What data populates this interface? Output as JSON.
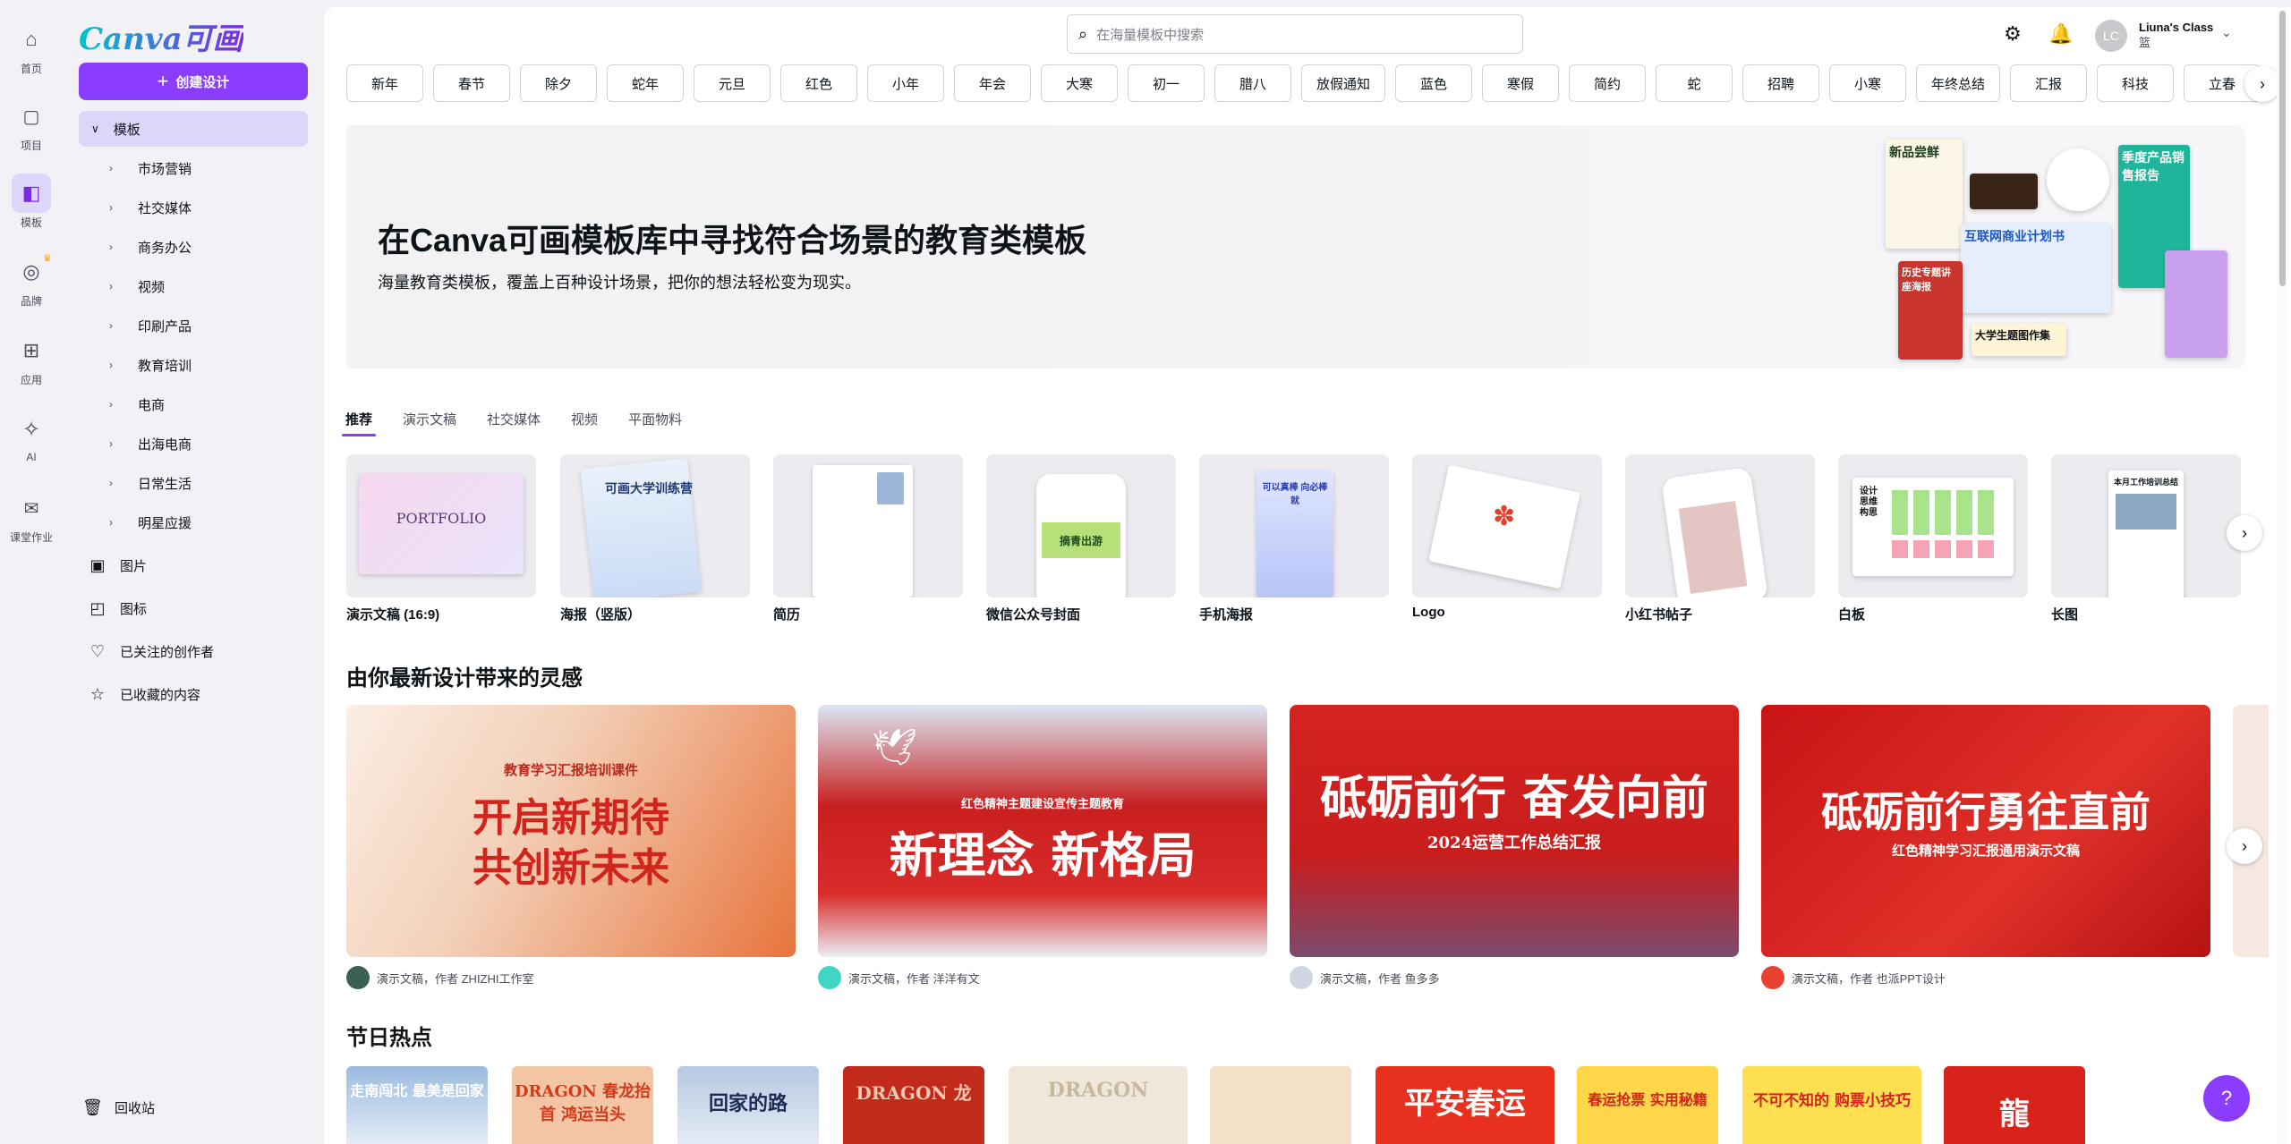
{
  "rail": [
    {
      "key": "home",
      "label": "首页",
      "icon": "⌂"
    },
    {
      "key": "projects",
      "label": "项目",
      "icon": "▢"
    },
    {
      "key": "templates",
      "label": "模板",
      "icon": "◧"
    },
    {
      "key": "brand",
      "label": "品牌",
      "icon": "◎"
    },
    {
      "key": "apps",
      "label": "应用",
      "icon": "⊞"
    },
    {
      "key": "ai",
      "label": "AI",
      "icon": "✧"
    },
    {
      "key": "classwork",
      "label": "课堂作业",
      "icon": "✉"
    }
  ],
  "panel": {
    "logo": "Canva可画",
    "create_label": "创建设计",
    "tree_head": "模板",
    "tree_items": [
      "市场营销",
      "社交媒体",
      "商务办公",
      "视频",
      "印刷产品",
      "教育培训",
      "电商",
      "出海电商",
      "日常生活",
      "明星应援"
    ],
    "links": [
      {
        "label": "图片",
        "icon": "▣"
      },
      {
        "label": "图标",
        "icon": "◰"
      },
      {
        "label": "已关注的创作者",
        "icon": "♡"
      },
      {
        "label": "已收藏的内容",
        "icon": "☆"
      }
    ],
    "trash": "回收站"
  },
  "header": {
    "search_placeholder": "在海量模板中搜索",
    "avatar_initials": "LC",
    "user_name": "Liuna's Class",
    "user_sub": "篮"
  },
  "chips": [
    "新年",
    "春节",
    "除夕",
    "蛇年",
    "元旦",
    "红色",
    "小年",
    "年会",
    "大寒",
    "初一",
    "腊八",
    "放假通知",
    "蓝色",
    "寒假",
    "简约",
    "蛇",
    "招聘",
    "小寒",
    "年终总结",
    "汇报",
    "科技",
    "立春"
  ],
  "hero": {
    "title": "在Canva可画模板库中寻找符合场景的教育类模板",
    "subtitle": "海量教育类模板，覆盖上百种设计场景，把你的想法轻松变为现实。",
    "collage": [
      "新品尝鲜",
      "互联网商业计划书",
      "季度产品销售报告",
      "历史专题讲座海报",
      "大学生题图作集"
    ]
  },
  "tabs": [
    "推荐",
    "演示文稿",
    "社交媒体",
    "视频",
    "平面物料"
  ],
  "types": [
    {
      "label": "演示文稿 (16:9)",
      "thumb_text": "PORTFOLIO"
    },
    {
      "label": "海报（竖版）",
      "thumb_text": "可画大学训练营"
    },
    {
      "label": "简历",
      "thumb_text": ""
    },
    {
      "label": "微信公众号封面",
      "thumb_text": "摘青出游"
    },
    {
      "label": "手机海报",
      "thumb_text": "可以真棒 向必棒就"
    },
    {
      "label": "Logo",
      "thumb_text": ""
    },
    {
      "label": "小红书帖子",
      "thumb_text": ""
    },
    {
      "label": "白板",
      "thumb_text": "设计思维构思"
    },
    {
      "label": "长图",
      "thumb_text": "本月工作培训总结"
    }
  ],
  "inspiration": {
    "title": "由你最新设计带来的灵感",
    "cards": [
      {
        "title_line1": "开启新期待",
        "title_line2": "共创新未来",
        "top": "教育学习汇报培训课件",
        "meta": "演示文稿，作者 ZHIZHI工作室"
      },
      {
        "title_line1": "新理念 新格局",
        "title_line2": "",
        "top": "红色精神主题建设宣传主题教育",
        "meta": "演示文稿，作者 洋洋有文"
      },
      {
        "title_line1": "砥砺前行 奋发向前",
        "title_line2": "",
        "top": "2024运营工作总结汇报",
        "meta": "演示文稿，作者 鱼多多"
      },
      {
        "title_line1": "砥砺前行勇往直前",
        "title_line2": "",
        "top": "红色精神学习汇报通用演示文稿",
        "meta": "演示文稿，作者 也派PPT设计"
      }
    ]
  },
  "holiday": {
    "title": "节日热点",
    "cards": [
      "走南闯北 最美是回家",
      "DRAGON 春龙抬首 鸿运当头",
      "回家的路",
      "DRAGON 龙",
      "DRAGON",
      "",
      "平安春运",
      "春运抢票 实用秘籍",
      "不可不知的 购票小技巧",
      "龍"
    ]
  },
  "help_label": "?"
}
